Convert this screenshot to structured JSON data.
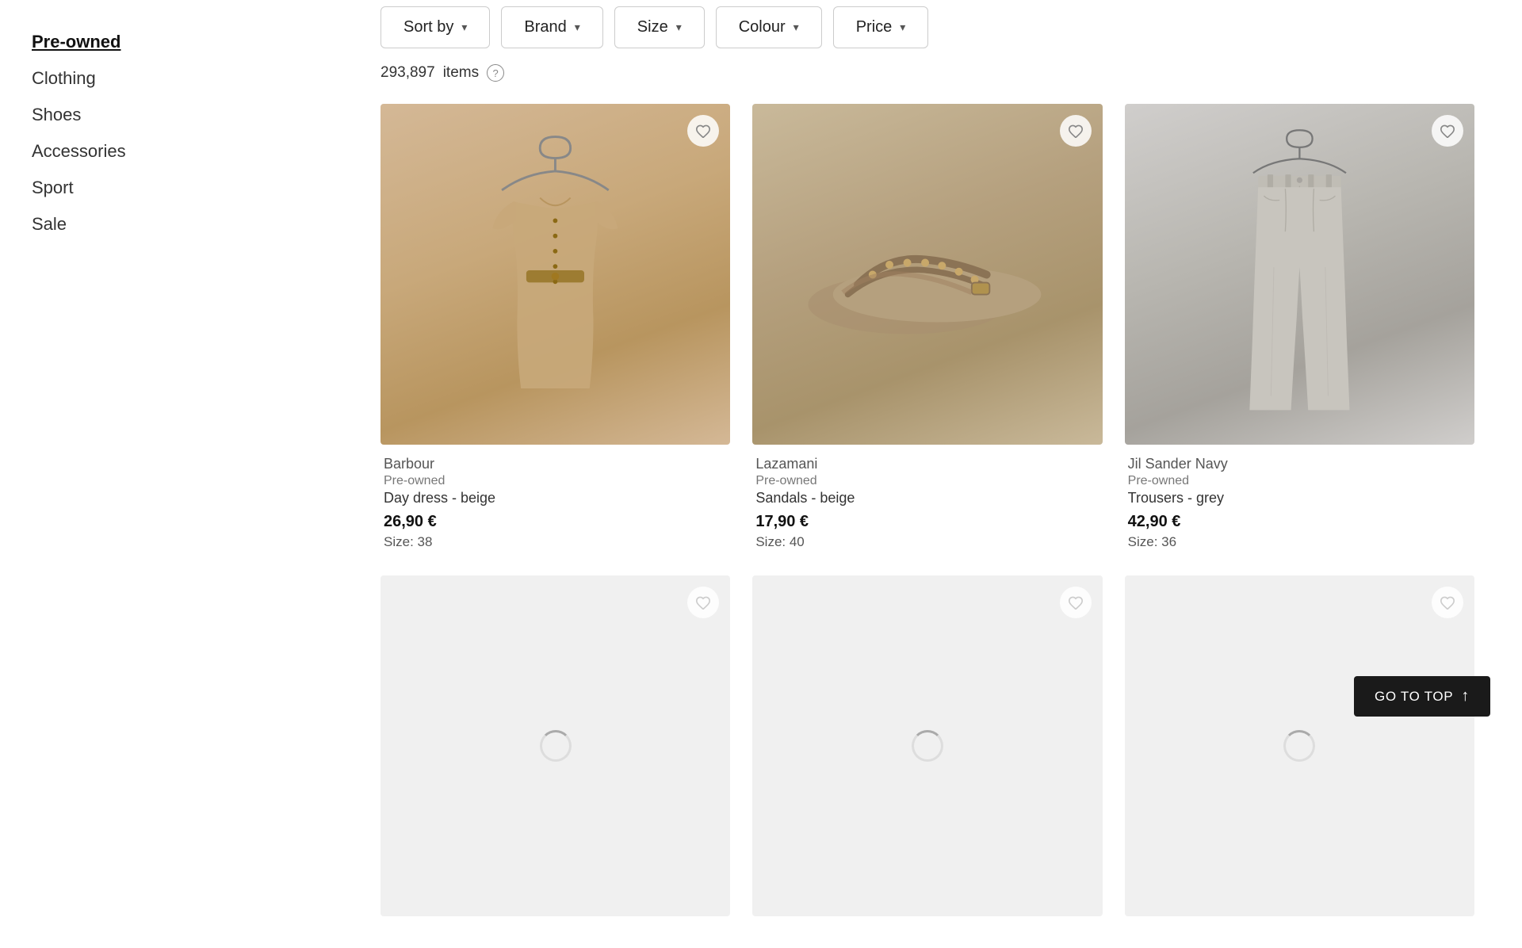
{
  "sidebar": {
    "items": [
      {
        "id": "pre-owned",
        "label": "Pre-owned",
        "active": true
      },
      {
        "id": "clothing",
        "label": "Clothing",
        "active": false
      },
      {
        "id": "shoes",
        "label": "Shoes",
        "active": false
      },
      {
        "id": "accessories",
        "label": "Accessories",
        "active": false
      },
      {
        "id": "sport",
        "label": "Sport",
        "active": false
      },
      {
        "id": "sale",
        "label": "Sale",
        "active": false
      }
    ]
  },
  "filters": {
    "sort_by": "Sort by",
    "brand": "Brand",
    "size": "Size",
    "colour": "Colour",
    "price": "Price"
  },
  "items_count": {
    "count": "293,897",
    "label": "items"
  },
  "products": [
    {
      "id": "1",
      "brand": "Barbour",
      "condition": "Pre-owned",
      "name": "Day dress - beige",
      "price": "26,90 €",
      "size": "Size: 38",
      "image_type": "dress",
      "wishlisted": false
    },
    {
      "id": "2",
      "brand": "Lazamani",
      "condition": "Pre-owned",
      "name": "Sandals - beige",
      "price": "17,90 €",
      "size": "Size: 40",
      "image_type": "sandals",
      "wishlisted": false
    },
    {
      "id": "3",
      "brand": "Jil Sander Navy",
      "condition": "Pre-owned",
      "name": "Trousers - grey",
      "price": "42,90 €",
      "size": "Size: 36",
      "image_type": "trousers",
      "wishlisted": false
    },
    {
      "id": "4",
      "brand": "",
      "condition": "",
      "name": "",
      "price": "",
      "size": "",
      "image_type": "loading",
      "wishlisted": false
    },
    {
      "id": "5",
      "brand": "",
      "condition": "",
      "name": "",
      "price": "",
      "size": "",
      "image_type": "loading",
      "wishlisted": false
    },
    {
      "id": "6",
      "brand": "",
      "condition": "",
      "name": "",
      "price": "",
      "size": "",
      "image_type": "loading",
      "wishlisted": false
    }
  ],
  "go_to_top": {
    "label": "GO TO TOP"
  }
}
